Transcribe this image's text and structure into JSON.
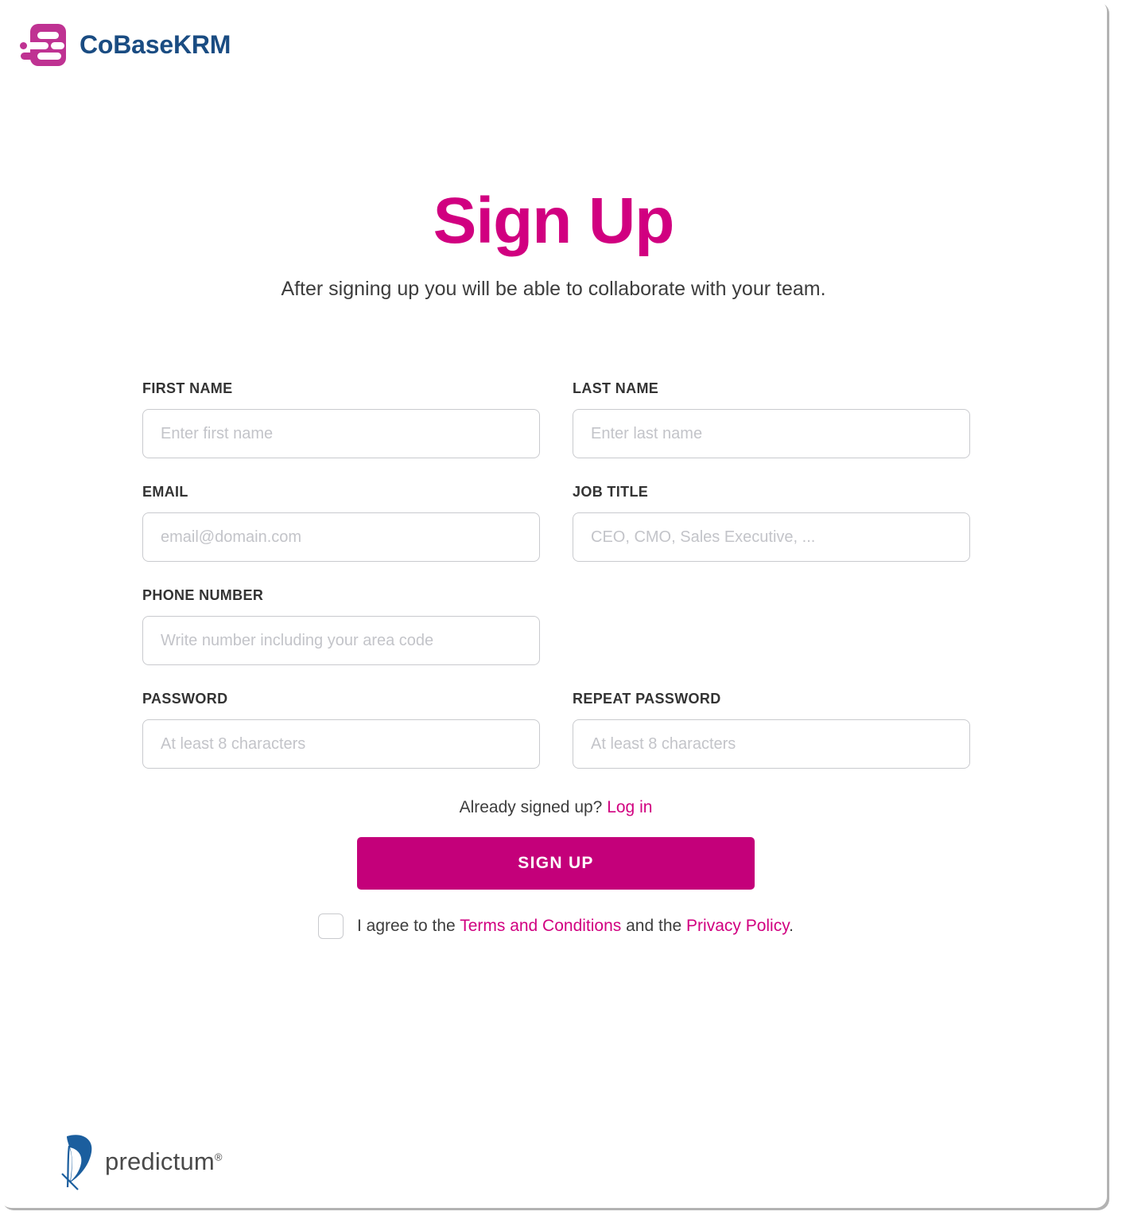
{
  "brand": {
    "name": "CoBaseKRM",
    "logo_icon": "cobase-document-speed-icon",
    "accent_blue": "#1a4c82",
    "accent_magenta": "#c4007a"
  },
  "hero": {
    "title": "Sign Up",
    "subtitle": "After signing up you will be able to collaborate with your team."
  },
  "form": {
    "fields": [
      {
        "name": "first-name",
        "label": "FIRST NAME",
        "placeholder": "Enter first name",
        "value": "",
        "type": "text"
      },
      {
        "name": "last-name",
        "label": "LAST NAME",
        "placeholder": "Enter last name",
        "value": "",
        "type": "text"
      },
      {
        "name": "email",
        "label": "EMAIL",
        "placeholder": "email@domain.com",
        "value": "",
        "type": "email"
      },
      {
        "name": "job-title",
        "label": "JOB TITLE",
        "placeholder": "CEO, CMO, Sales Executive, ...",
        "value": "",
        "type": "text"
      },
      {
        "name": "phone-number",
        "label": "PHONE NUMBER",
        "placeholder": "Write number including your area code",
        "value": "",
        "type": "tel"
      },
      {
        "name": "password",
        "label": "PASSWORD",
        "placeholder": "At least 8 characters",
        "value": "",
        "type": "password"
      },
      {
        "name": "repeat-password",
        "label": "REPEAT PASSWORD",
        "placeholder": "At least 8 characters",
        "value": "",
        "type": "password"
      }
    ]
  },
  "actions": {
    "login_prompt": "Already signed up?",
    "login_link": "Log in",
    "signup_label": "SIGN UP"
  },
  "terms": {
    "checked": false,
    "prefix": "I agree to the ",
    "terms_link": "Terms and Conditions",
    "middle": " and the ",
    "privacy_link": "Privacy Policy",
    "suffix": "."
  },
  "footer": {
    "name": "predictum",
    "registered_mark": "®",
    "logo_icon": "predictum-leaf-icon"
  }
}
